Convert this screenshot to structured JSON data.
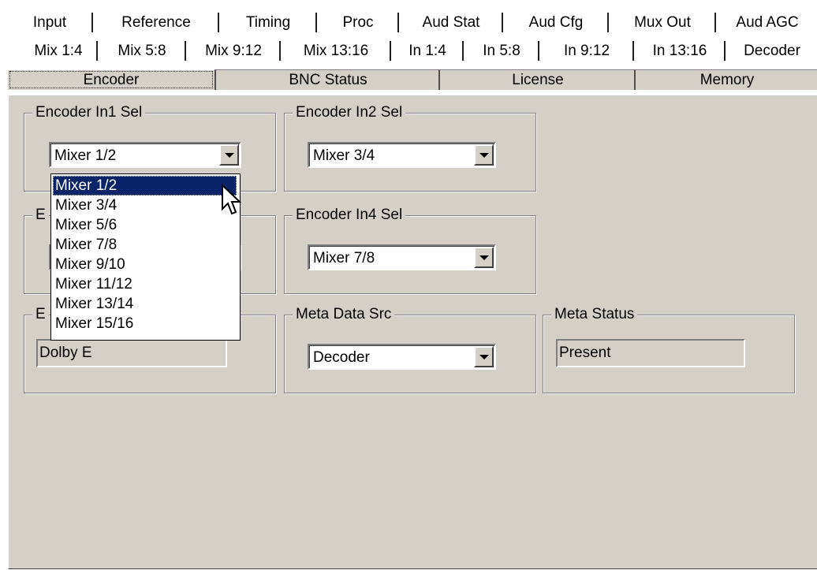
{
  "tabs": {
    "row1": [
      "Input",
      "Reference",
      "Timing",
      "Proc",
      "Aud Stat",
      "Aud Cfg",
      "Mux Out",
      "Aud AGC"
    ],
    "row2": [
      "Mix 1:4",
      "Mix 5:8",
      "Mix 9:12",
      "Mix 13:16",
      "In 1:4",
      "In 5:8",
      "In 9:12",
      "In 13:16",
      "Decoder"
    ],
    "row3": [
      "Encoder",
      "BNC Status",
      "License",
      "Memory"
    ],
    "active": "Encoder"
  },
  "groups": {
    "enc_in1": {
      "legend": "Encoder In1 Sel",
      "value": "Mixer 1/2"
    },
    "enc_in2": {
      "legend": "Encoder In2 Sel",
      "value": "Mixer 3/4"
    },
    "enc_in3": {
      "legend_visible": "E",
      "value": ""
    },
    "enc_in4": {
      "legend": "Encoder In4 Sel",
      "value": "Mixer 7/8"
    },
    "enc_type": {
      "legend_visible": "E",
      "value": "Dolby E"
    },
    "meta_src": {
      "legend": "Meta Data Src",
      "value": "Decoder"
    },
    "meta_status": {
      "legend": "Meta Status",
      "value": "Present"
    }
  },
  "dropdown": {
    "options": [
      "Mixer 1/2",
      "Mixer 3/4",
      "Mixer 5/6",
      "Mixer 7/8",
      "Mixer 9/10",
      "Mixer 11/12",
      "Mixer 13/14",
      "Mixer 15/16"
    ],
    "selected_index": 0
  },
  "colors": {
    "panel_bg": "#d4d0c8",
    "selection_bg": "#0a246a"
  }
}
